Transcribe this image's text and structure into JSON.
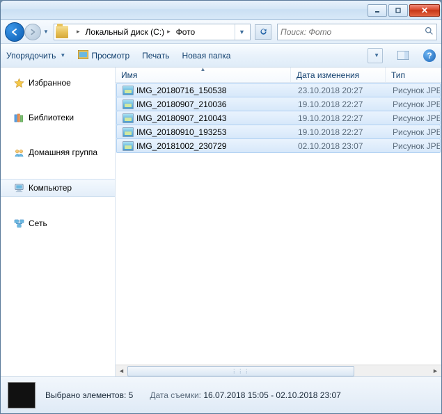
{
  "breadcrumb": {
    "drive": "Локальный диск (C:)",
    "folder": "Фото"
  },
  "search": {
    "placeholder": "Поиск: Фото"
  },
  "toolbar": {
    "organize": "Упорядочить",
    "preview": "Просмотр",
    "print": "Печать",
    "newfolder": "Новая папка"
  },
  "sidebar": {
    "favorites": "Избранное",
    "libraries": "Библиотеки",
    "homegroup": "Домашняя группа",
    "computer": "Компьютер",
    "network": "Сеть"
  },
  "columns": {
    "name": "Имя",
    "date": "Дата изменения",
    "type": "Тип"
  },
  "files": [
    {
      "name": "IMG_20180716_150538",
      "date": "23.10.2018 20:27",
      "type": "Рисунок JPE"
    },
    {
      "name": "IMG_20180907_210036",
      "date": "19.10.2018 22:27",
      "type": "Рисунок JPE"
    },
    {
      "name": "IMG_20180907_210043",
      "date": "19.10.2018 22:27",
      "type": "Рисунок JPE"
    },
    {
      "name": "IMG_20180910_193253",
      "date": "19.10.2018 22:27",
      "type": "Рисунок JPE"
    },
    {
      "name": "IMG_20181002_230729",
      "date": "02.10.2018 23:07",
      "type": "Рисунок JPE"
    }
  ],
  "status": {
    "selected_label": "Выбрано элементов:",
    "selected_count": "5",
    "date_taken_label": "Дата съемки:",
    "date_taken_value": "16.07.2018 15:05 - 02.10.2018 23:07"
  }
}
